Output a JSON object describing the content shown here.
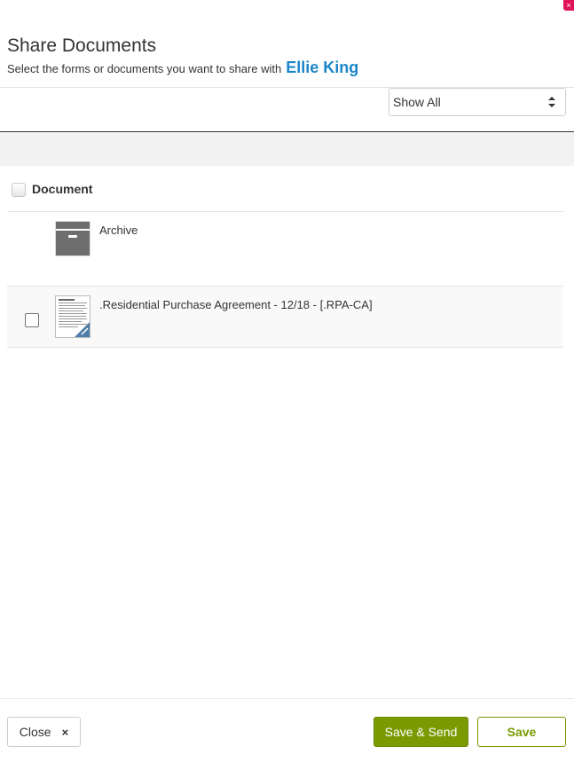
{
  "dialog": {
    "title": "Share Documents",
    "subtitle_prefix": "Select the forms or documents you want to share with",
    "recipient": "Ellie King",
    "close_glyph": "×"
  },
  "filter": {
    "selected": "Show All"
  },
  "table": {
    "header_label": "Document",
    "rows": [
      {
        "name": "Archive",
        "icon": "archive-box-icon",
        "has_checkbox": false
      },
      {
        "name": ".Residential Purchase Agreement - 12/18 - [.RPA-CA]",
        "icon": "document-thumbnail-icon",
        "has_checkbox": true,
        "checked": false
      }
    ]
  },
  "footer": {
    "close_label": "Close",
    "close_icon_glyph": "×",
    "save_send_label": "Save & Send",
    "save_label": "Save"
  },
  "colors": {
    "accent_blue": "#1a86c8",
    "primary_green": "#7a9a01",
    "close_pink": "#e0145a"
  }
}
